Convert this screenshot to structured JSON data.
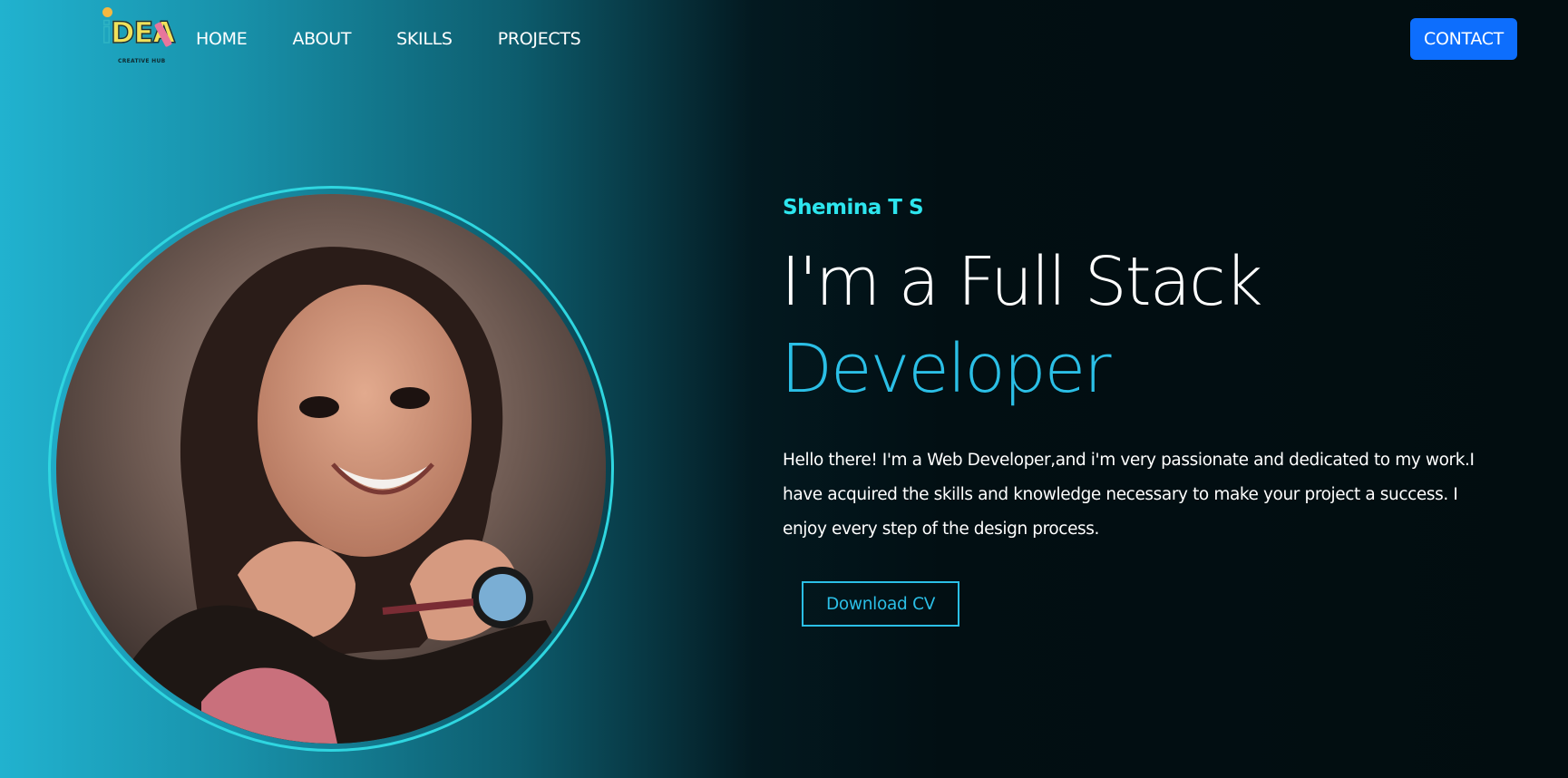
{
  "logo": {
    "word": "iDEA",
    "subtitle": "CREATIVE HUB"
  },
  "nav": {
    "links": [
      "HOME",
      "ABOUT",
      "SKILLS",
      "PROJECTS"
    ],
    "contact_label": "CONTACT"
  },
  "hero": {
    "name": "Shemina T S",
    "title_line1": "I'm a Full Stack",
    "title_line2": "Developer",
    "description": "Hello there! I'm a Web Developer,and i'm very passionate and dedicated to my work.I have acquired the skills and knowledge necessary to make your project a success. I enjoy every step of the design process.",
    "download_label": "Download CV"
  },
  "colors": {
    "accent_cyan": "#2de5ee",
    "accent_blue": "#2bbfe6",
    "contact_blue": "#0d6efd",
    "background_dark": "#020d10"
  }
}
